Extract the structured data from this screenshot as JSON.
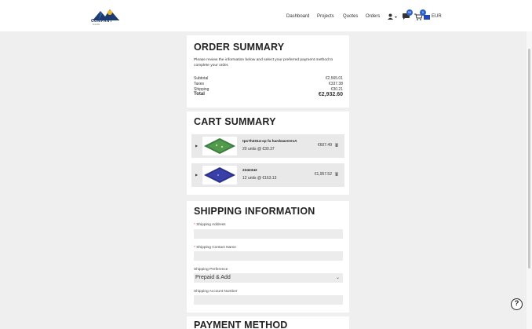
{
  "header": {
    "logo_text": "COMPANY",
    "logo_sub": "NAME",
    "nav": [
      "Dashboard",
      "Projects",
      "Quotes",
      "Orders"
    ],
    "notifications_badge": "99",
    "cart_badge": "0",
    "currency": "EUR",
    "brand_color": "#1c3b6e",
    "accent_color": "#2f62c9"
  },
  "order_summary": {
    "title": "ORDER SUMMARY",
    "description": "Please review the information below and select your preferred payment method to complete your order.",
    "rows": [
      {
        "label": "Subtotal",
        "value": "€2,565.01"
      },
      {
        "label": "Taxes",
        "value": "€337.38"
      },
      {
        "label": "Shipping",
        "value": "€30.21"
      }
    ],
    "total_label": "Total",
    "total_value": "€2,932.60"
  },
  "cart_summary": {
    "title": "CART SUMMARY",
    "items": [
      {
        "name": "tps7h2014-sp fa hardwarerevA",
        "qty": "20 units @ €30.37",
        "price": "€607.49",
        "board_color": "#3a7a3a"
      },
      {
        "name": "2342342",
        "qty": "12 units @ €163.13",
        "price": "€1,957.52",
        "board_color": "#2a2f8a"
      }
    ]
  },
  "shipping": {
    "title": "SHIPPING INFORMATION",
    "address_label": "Shipping Address",
    "contact_label": "Shipping Contact Name",
    "preference_label": "Shipping Preference",
    "preference_value": "Prepaid & Add",
    "account_label": "Shipping Account Number",
    "required_mark": "*"
  },
  "payment": {
    "title": "PAYMENT METHOD"
  },
  "help": {
    "label": "?"
  }
}
